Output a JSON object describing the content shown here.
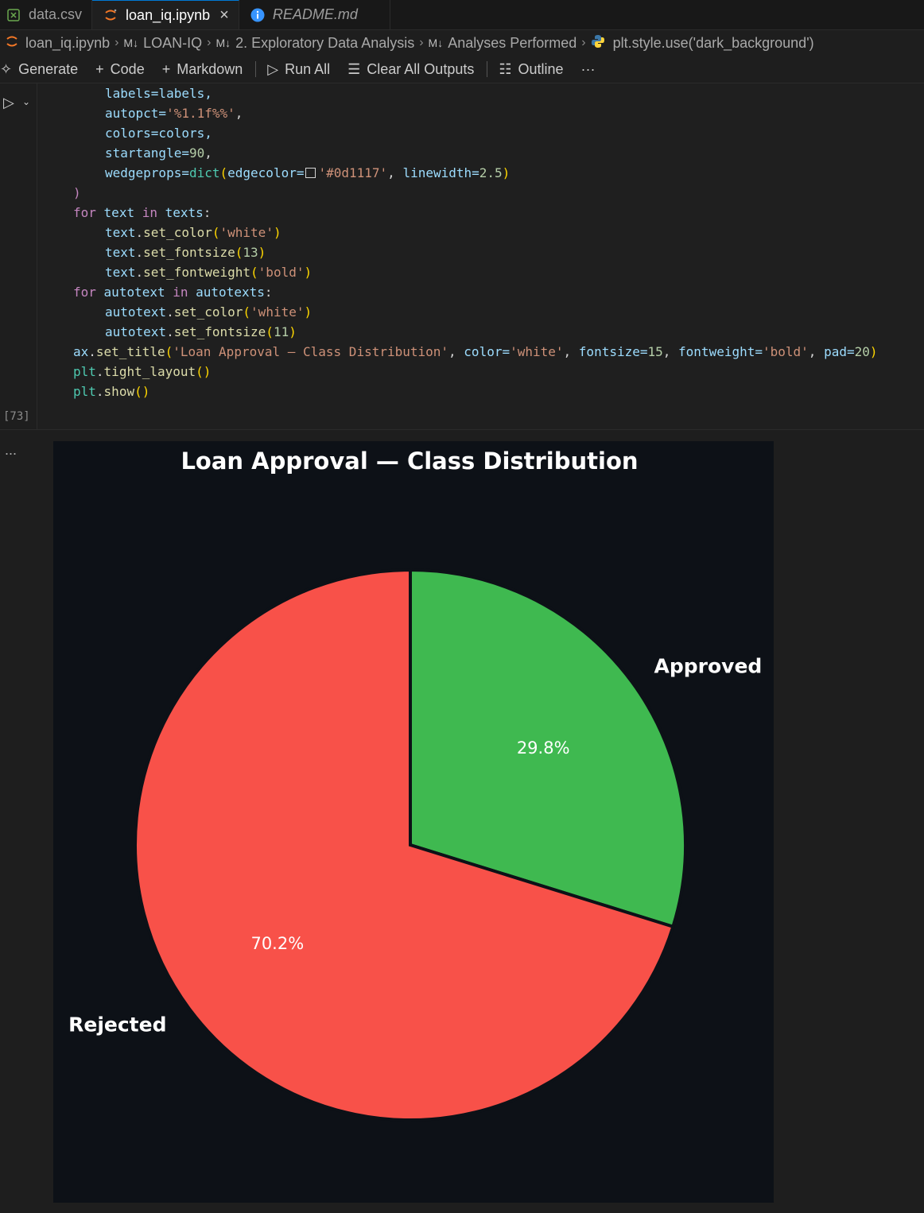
{
  "tabs": [
    {
      "label": "data.csv",
      "icon": "csv-file-icon"
    },
    {
      "label": "loan_iq.ipynb",
      "icon": "jupyter-icon",
      "active": true
    },
    {
      "label": "README.md",
      "icon": "info-icon",
      "italic": true
    }
  ],
  "breadcrumb": {
    "file": "loan_iq.ipynb",
    "items": [
      "LOAN-IQ",
      "2. Exploratory Data Analysis",
      "Analyses Performed"
    ],
    "md_marker": "M↓",
    "last": "plt.style.use('dark_background')"
  },
  "toolbar": {
    "generate": "Generate",
    "code": "Code",
    "markdown": "Markdown",
    "run_all": "Run All",
    "clear_outputs": "Clear All Outputs",
    "outline": "Outline",
    "more": "···"
  },
  "code": {
    "line1": "labels=labels,",
    "line2_a": "autopct=",
    "line2_b": "'%1.1f%%'",
    "line3": "colors=colors,",
    "line4_a": "startangle=",
    "line4_b": "90",
    "line5_a": "wedgeprops=",
    "line5_b": "dict",
    "line5_c": "edgecolor=",
    "line5_d": "'#0d1117'",
    "line5_e": "linewidth=",
    "line5_f": "2.5",
    "line6": ")",
    "for1_a": "for",
    "for1_b": "text",
    "for1_c": "in",
    "for1_d": "texts",
    "t1_a": "text",
    "t1_b": "set_color",
    "t1_c": "'white'",
    "t2_b": "set_fontsize",
    "t2_c": "13",
    "t3_b": "set_fontweight",
    "t3_c": "'bold'",
    "for2_b": "autotext",
    "for2_d": "autotexts",
    "a1_c": "'white'",
    "a2_c": "11",
    "title_a": "ax",
    "title_b": "set_title",
    "title_c": "'Loan Approval — Class Distribution'",
    "title_d": "color=",
    "title_e": "'white'",
    "title_f": "fontsize=",
    "title_g": "15",
    "title_h": "fontweight=",
    "title_i": "'bold'",
    "title_j": "pad=",
    "title_k": "20",
    "plt": "plt",
    "tight": "tight_layout",
    "show": "show",
    "exec_count": "[73]"
  },
  "output_ellipsis": "...",
  "chart_data": {
    "type": "pie",
    "title": "Loan Approval — Class Distribution",
    "startangle": 90,
    "slices": [
      {
        "label": "Approved",
        "value": 29.8,
        "pct_label": "29.8%",
        "color": "#3fb950"
      },
      {
        "label": "Rejected",
        "value": 70.2,
        "pct_label": "70.2%",
        "color": "#f85149"
      }
    ],
    "background": "#0d1117",
    "edgecolor": "#0d1117"
  }
}
